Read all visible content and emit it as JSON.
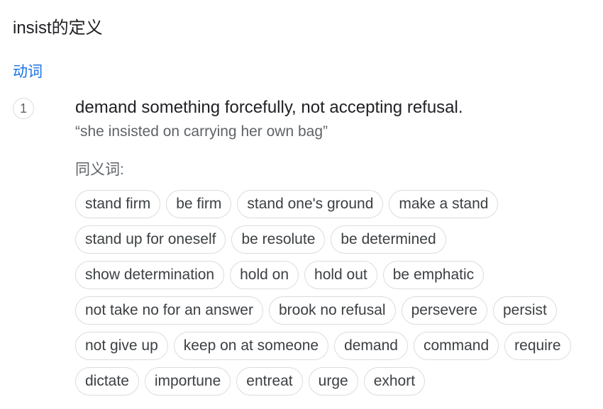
{
  "heading": {
    "title": "insist的定义"
  },
  "entry": {
    "part_of_speech": "动词",
    "sense_number": "1",
    "definition": "demand something forcefully, not accepting refusal.",
    "example": "“she insisted on carrying her own bag”",
    "synonyms_label": "同义词:",
    "synonym_rows": [
      [
        "stand firm",
        "be firm",
        "stand one's ground",
        "make a stand"
      ],
      [
        "stand up for oneself",
        "be resolute",
        "be determined"
      ],
      [
        "show determination",
        "hold on",
        "hold out",
        "be emphatic"
      ],
      [
        "not take no for an answer",
        "brook no refusal",
        "persevere",
        "persist"
      ],
      [
        "not give up",
        "keep on at someone",
        "demand",
        "command",
        "require"
      ],
      [
        "dictate",
        "importune",
        "entreat",
        "urge",
        "exhort"
      ]
    ]
  }
}
